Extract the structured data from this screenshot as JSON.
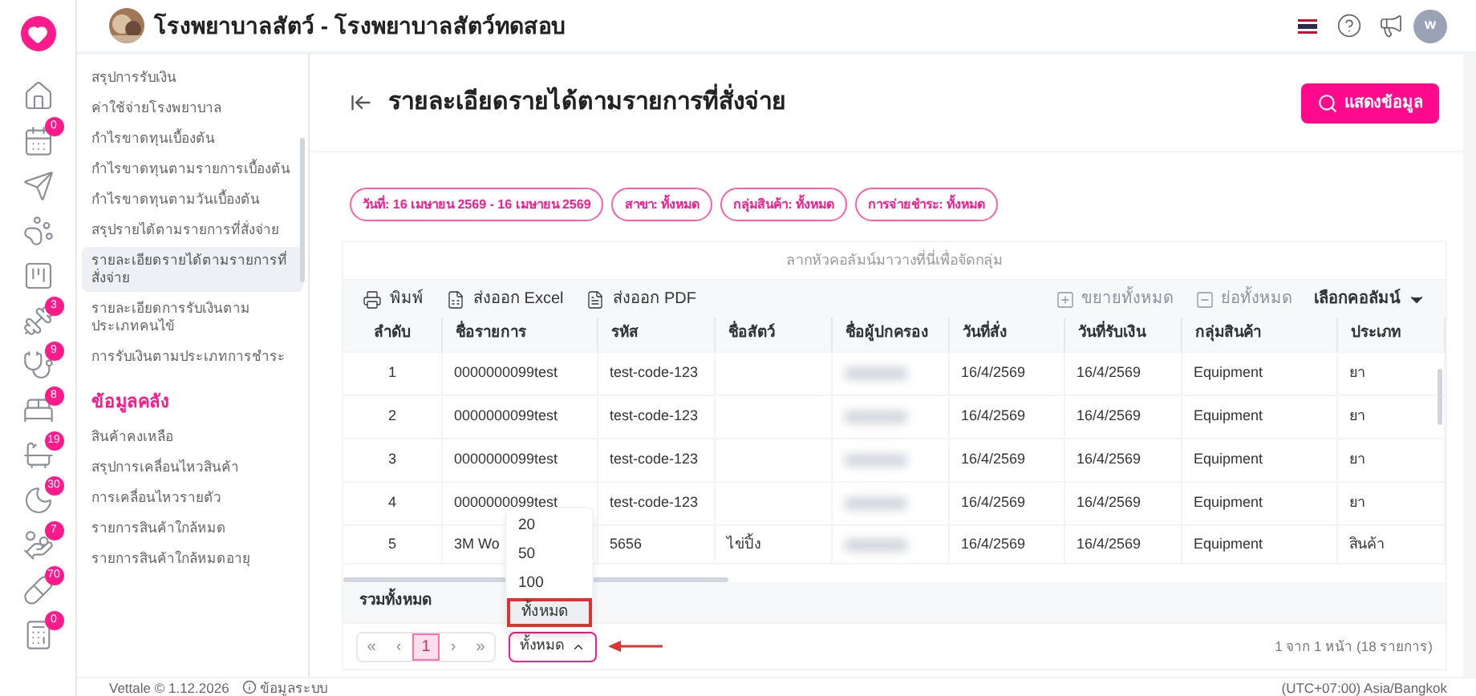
{
  "rail": [
    {
      "kind": "plain"
    },
    {
      "kind": "badged",
      "badge": "0"
    },
    {
      "kind": "plain"
    },
    {
      "kind": "plain"
    },
    {
      "kind": "plain"
    },
    {
      "kind": "badged",
      "badge": "3"
    },
    {
      "kind": "badged",
      "badge": "9"
    },
    {
      "kind": "badged",
      "badge": "8"
    },
    {
      "kind": "badged",
      "badge": "19"
    },
    {
      "kind": "badged",
      "badge": "30"
    },
    {
      "kind": "badged",
      "badge": "7"
    },
    {
      "kind": "badged",
      "badge": "70"
    },
    {
      "kind": "badged",
      "badge": "0"
    }
  ],
  "topbar": {
    "title": "โรงพยาบาลสัตว์ - โรงพยาบาลสัตว์ทดสอบ",
    "user_initial": "w"
  },
  "sidebar": {
    "items": [
      {
        "label": "สรุปการรับเงิน",
        "selected": false
      },
      {
        "label": "ค่าใช้จ่ายโรงพยาบาล",
        "selected": false
      },
      {
        "label": "กำไรขาดทุนเบื้องต้น",
        "selected": false
      },
      {
        "label": "กำไรขาดทุนตามรายการเบื้องต้น",
        "selected": false
      },
      {
        "label": "กำไรขาดทุนตามวันเบื้องต้น",
        "selected": false
      },
      {
        "label": "สรุปรายได้ตามรายการที่สั่งจ่าย",
        "selected": false
      },
      {
        "label": "รายละเอียดรายได้ตามรายการที่สั่งจ่าย",
        "selected": true
      },
      {
        "label": "รายละเอียดการรับเงินตามประเภทคนไข้",
        "selected": false
      },
      {
        "label": "การรับเงินตามประเภทการชำระ",
        "selected": false
      }
    ],
    "section": "ข้อมูลคลัง",
    "section_items": [
      {
        "label": "สินค้าคงเหลือ",
        "selected": false
      },
      {
        "label": "สรุปการเคลื่อนไหวสินค้า",
        "selected": false
      },
      {
        "label": "การเคลื่อนไหวรายตัว",
        "selected": false
      },
      {
        "label": "รายการสินค้าใกล้หมด",
        "selected": false
      },
      {
        "label": "รายการสินค้าใกล้หมดอายุ",
        "selected": false
      }
    ]
  },
  "page": {
    "title": "รายละเอียดรายได้ตามรายการที่สั่งจ่าย",
    "show_button": "แสดงข้อมูล"
  },
  "filters": [
    "วันที่: 16 เมษายน 2569 - 16 เมษายน 2569",
    "สาขา: ทั้งหมด",
    "กลุ่มสินค้า: ทั้งหมด",
    "การจ่ายชำระ: ทั้งหมด"
  ],
  "table": {
    "group_hint": "ลากหัวคอลัมน์มาวางที่นี่เพื่อจัดกลุ่ม",
    "toolbar": [
      {
        "kind": "print",
        "label": "พิมพ์",
        "disabled": false
      },
      {
        "kind": "excel",
        "label": "ส่งออก Excel",
        "disabled": false
      },
      {
        "kind": "pdf",
        "label": "ส่งออก PDF",
        "disabled": false
      }
    ],
    "toolbar_right": [
      {
        "kind": "expand",
        "label": "ขยายทั้งหมด",
        "disabled": true
      },
      {
        "kind": "collapse",
        "label": "ย่อทั้งหมด",
        "disabled": true
      },
      {
        "kind": "columns",
        "label": "เลือกคอลัมน์",
        "disabled": false
      }
    ],
    "columns": [
      "ลำดับ",
      "ชื่อรายการ",
      "รหัส",
      "ชื่อสัตว์",
      "ชื่อผู้ปกครอง",
      "วันที่สั่ง",
      "วันที่รับเงิน",
      "กลุ่มสินค้า",
      "ประเภท"
    ],
    "rows": [
      [
        "1",
        "0000000099test",
        "test-code-123",
        "",
        "",
        "16/4/2569",
        "16/4/2569",
        "Equipment",
        "ยา"
      ],
      [
        "2",
        "0000000099test",
        "test-code-123",
        "",
        "",
        "16/4/2569",
        "16/4/2569",
        "Equipment",
        "ยา"
      ],
      [
        "3",
        "0000000099test",
        "test-code-123",
        "",
        "",
        "16/4/2569",
        "16/4/2569",
        "Equipment",
        "ยา"
      ],
      [
        "4",
        "0000000099test",
        "test-code-123",
        "",
        "",
        "16/4/2569",
        "16/4/2569",
        "Equipment",
        "ยา"
      ],
      [
        "5",
        "3M Wo",
        "5656",
        "ไข่ปิ้ง",
        "",
        "16/4/2569",
        "16/4/2569",
        "Equipment",
        "สินค้า"
      ]
    ],
    "total_label": "รวมทั้งหมด",
    "pager": [
      {
        "label": "«",
        "selected": false,
        "disabled": true
      },
      {
        "label": "‹",
        "selected": false,
        "disabled": true
      },
      {
        "label": "1",
        "selected": true,
        "disabled": false
      },
      {
        "label": "›",
        "selected": false,
        "disabled": true
      },
      {
        "label": "»",
        "selected": false,
        "disabled": true
      }
    ],
    "page_size": {
      "value": "ทั้งหมด",
      "expanded": true,
      "options": [
        {
          "label": "20",
          "selected": false
        },
        {
          "label": "50",
          "selected": false
        },
        {
          "label": "100",
          "selected": false
        },
        {
          "label": "ทั้งหมด",
          "selected": true
        }
      ]
    },
    "page_info": "1 จาก 1 หน้า (18 รายการ)"
  },
  "footer": {
    "version": "Vettale © 1.12.2026",
    "system_info": "ข้อมูลระบบ",
    "timezone": "(UTC+07:00) Asia/Bangkok"
  }
}
